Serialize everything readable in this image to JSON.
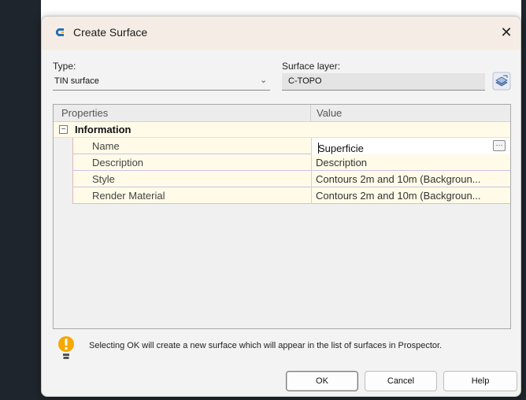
{
  "window": {
    "title": "Create Surface",
    "close_glyph": "✕"
  },
  "type": {
    "label": "Type:",
    "value": "TIN surface",
    "chevron": "⌄"
  },
  "surface_layer": {
    "label": "Surface layer:",
    "value": "C-TOPO"
  },
  "grid": {
    "headers": {
      "properties": "Properties",
      "value": "Value"
    },
    "category": {
      "toggle": "−",
      "label": "Information"
    },
    "rows": [
      {
        "name": "Name",
        "value": "Superficie"
      },
      {
        "name": "Description",
        "value": "Description"
      },
      {
        "name": "Style",
        "value": "Contours 2m and 10m (Backgroun..."
      },
      {
        "name": "Render Material",
        "value": "Contours 2m and 10m (Backgroun..."
      }
    ],
    "ellipsis": "···"
  },
  "info": {
    "text": "Selecting OK will create a new surface which will appear in the list of surfaces in Prospector."
  },
  "buttons": {
    "ok": "OK",
    "cancel": "Cancel",
    "help": "Help"
  },
  "colors": {
    "titlebar": "#f5ede5",
    "property_row": "#fffbe8",
    "info_icon": "#f5a800",
    "app_icon": "#2a6fb8"
  },
  "icons": {
    "app": "civil-3d-icon",
    "layer": "layers-icon",
    "info": "lightbulb-warning-icon"
  }
}
